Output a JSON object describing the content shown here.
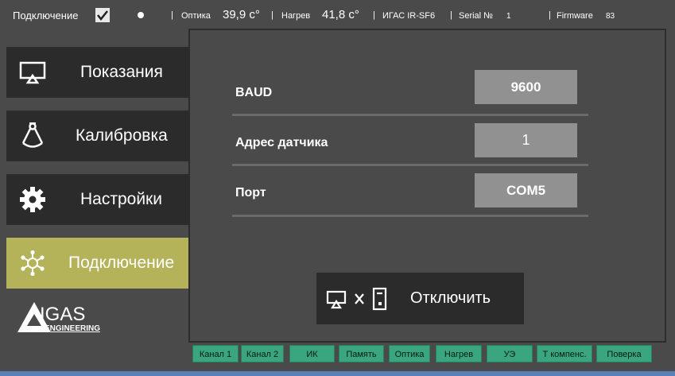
{
  "topbar": {
    "connection_label": "Подключение",
    "optics_label": "Оптика",
    "optics_value": "39,9 с°",
    "heat_label": "Нагрев",
    "heat_value": "41,8 с°",
    "device": "ИГАС IR-SF6",
    "serial_label": "Serial №",
    "serial_value": "1",
    "firmware_label": "Firmware",
    "firmware_value": "83",
    "sep": "|"
  },
  "sidebar": {
    "items": [
      {
        "label": "Показания",
        "icon": "monitor-icon",
        "active": false
      },
      {
        "label": "Калибровка",
        "icon": "caliper-icon",
        "active": false
      },
      {
        "label": "Настройки",
        "icon": "gear-icon",
        "active": false
      },
      {
        "label": "Подключение",
        "icon": "network-icon",
        "active": true
      }
    ]
  },
  "logo": {
    "text_main": "IGAS",
    "text_sub": "ENGINEERING"
  },
  "settings": {
    "baud_label": "BAUD",
    "baud_value": "9600",
    "address_label": "Адрес датчика",
    "address_value": "1",
    "port_label": "Порт",
    "port_value": "COM5"
  },
  "disconnect": {
    "label": "Отключить",
    "icon": "disconnect-icon"
  },
  "status_tabs": [
    "Канал 1",
    "Канал 2",
    "ИК",
    "Память",
    "Оптика",
    "Нагрев",
    "УЭ",
    "Т компенс.",
    "Поверка"
  ],
  "colors": {
    "background": "#4a4a4a",
    "nav_dark": "#2b2b2b",
    "nav_active": "#b5b35a",
    "field": "#919191",
    "tab_green": "#3aa680"
  }
}
